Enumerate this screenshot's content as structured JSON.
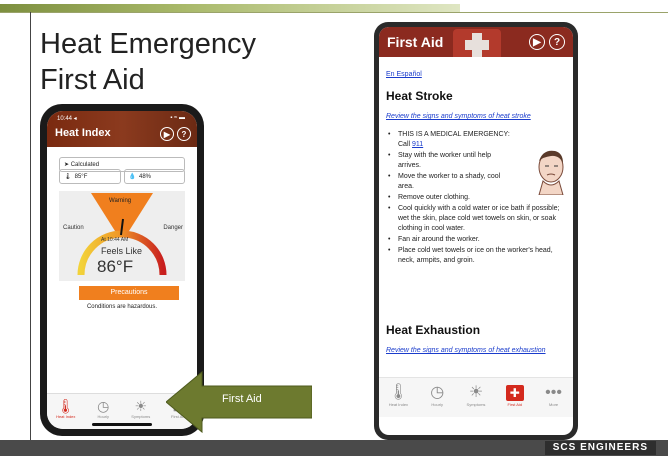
{
  "slide": {
    "title_line1": "Heat Emergency",
    "title_line2": "First Aid",
    "brand": "SCS ENGINEERS",
    "callout": "First Aid"
  },
  "left_phone": {
    "status_time": "10:44 ◂",
    "status_right": "▪ ≈ ▬",
    "title": "Heat Index",
    "calculated": "Calculated",
    "temperature": "85°F",
    "humidity": "48%",
    "warning": "Warning",
    "caution": "Caution",
    "danger": "Danger",
    "time_label": "At 10:44 AM",
    "feels_like": "Feels Like",
    "feels_temp": "86°F",
    "precautions": "Precautions",
    "conditions": "Conditions are hazardous.",
    "tabs": [
      "Heat Index",
      "Hourly",
      "Symptoms",
      "First Aid"
    ]
  },
  "right_phone": {
    "title": "First Aid",
    "espanol": "En Español",
    "heat_stroke": "Heat Stroke",
    "review_stroke": "Review the signs and symptoms of heat stroke",
    "items": [
      "THIS IS A MEDICAL EMERGENCY: Call ",
      "Stay with the worker until help arrives.",
      "Move the worker to a shady, cool area.",
      "Remove outer clothing.",
      "Cool quickly with a cold water or ice bath if possible; wet the skin, place cold wet towels on skin, or soak clothing in cool water.",
      "Fan air around the worker.",
      "Place cold wet towels or ice on the worker's head, neck, armpits, and groin."
    ],
    "emergency_number": "911",
    "heat_exhaustion": "Heat Exhaustion",
    "review_exhaustion": "Review the signs and symptoms of heat exhaustion",
    "tabs": [
      "Heat Index",
      "Hourly",
      "Symptoms",
      "First Aid",
      "More"
    ]
  },
  "colors": {
    "header_red": "#8b2a1f",
    "orange": "#f07f1e",
    "active_red": "#d42a1e",
    "link_blue": "#1a3ccc"
  },
  "icons": [
    "thermometer-icon",
    "clock-icon",
    "person-icon",
    "first-aid-kit-icon",
    "more-icon",
    "info-icon",
    "help-icon"
  ]
}
